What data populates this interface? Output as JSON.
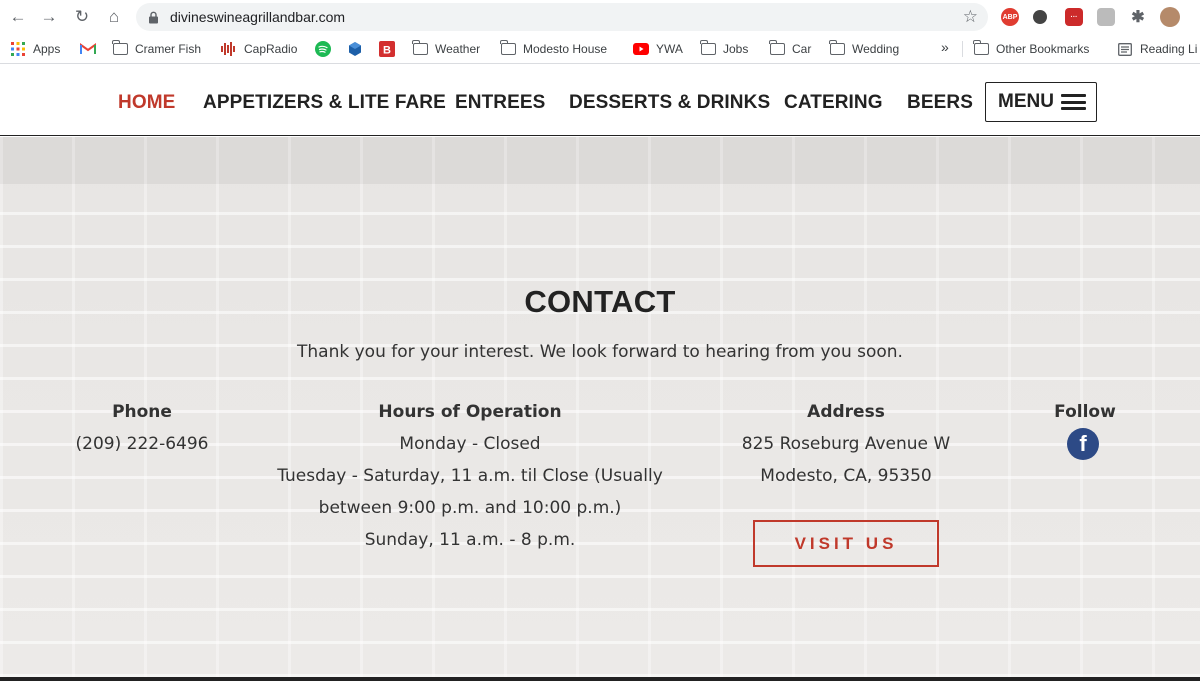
{
  "browser": {
    "url": "divineswineagrillandbar.com",
    "bookmarks": [
      {
        "label": "Apps",
        "icon": "apps-grid-icon"
      },
      {
        "label": "",
        "icon": "gmail-icon"
      },
      {
        "label": "Cramer Fish",
        "icon": "folder-icon"
      },
      {
        "label": "CapRadio",
        "icon": "capradio-icon"
      },
      {
        "label": "",
        "icon": "spotify-icon"
      },
      {
        "label": "",
        "icon": "cube-icon"
      },
      {
        "label": "",
        "icon": "b-icon"
      },
      {
        "label": "Weather",
        "icon": "folder-icon"
      },
      {
        "label": "Modesto House",
        "icon": "folder-icon"
      },
      {
        "label": "YWA",
        "icon": "youtube-icon"
      },
      {
        "label": "Jobs",
        "icon": "folder-icon"
      },
      {
        "label": "Car",
        "icon": "folder-icon"
      },
      {
        "label": "Wedding",
        "icon": "folder-icon"
      }
    ],
    "more_label": "»",
    "other_bookmarks": "Other Bookmarks",
    "reading_list": "Reading Li",
    "extensions": [
      "ABP",
      "",
      "",
      "",
      ""
    ]
  },
  "nav": {
    "home": "HOME",
    "appetizers": "APPETIZERS & LITE FARE",
    "entrees": "ENTREES",
    "desserts": "DESSERTS & DRINKS",
    "catering": "CATERING",
    "beers": "BEERS",
    "menu": "MENU"
  },
  "contact": {
    "title": "CONTACT",
    "subtitle": "Thank you for your interest. We look forward to hearing from you soon.",
    "phone": {
      "heading": "Phone",
      "value": "(209) 222-6496"
    },
    "hours": {
      "heading": "Hours of Operation",
      "lines": [
        "Monday - Closed",
        "Tuesday - Saturday, 11 a.m. til Close (Usually",
        "between 9:00 p.m. and 10:00 p.m.)",
        "Sunday, 11 a.m. - 8 p.m."
      ]
    },
    "address": {
      "heading": "Address",
      "lines": [
        "825 Roseburg Avenue W",
        "Modesto, CA, 95350"
      ],
      "button": "VISIT US"
    },
    "follow": {
      "heading": "Follow",
      "facebook": "f"
    }
  },
  "colors": {
    "accent": "#c0392b",
    "text": "#222222",
    "facebook": "#2d4a86"
  }
}
